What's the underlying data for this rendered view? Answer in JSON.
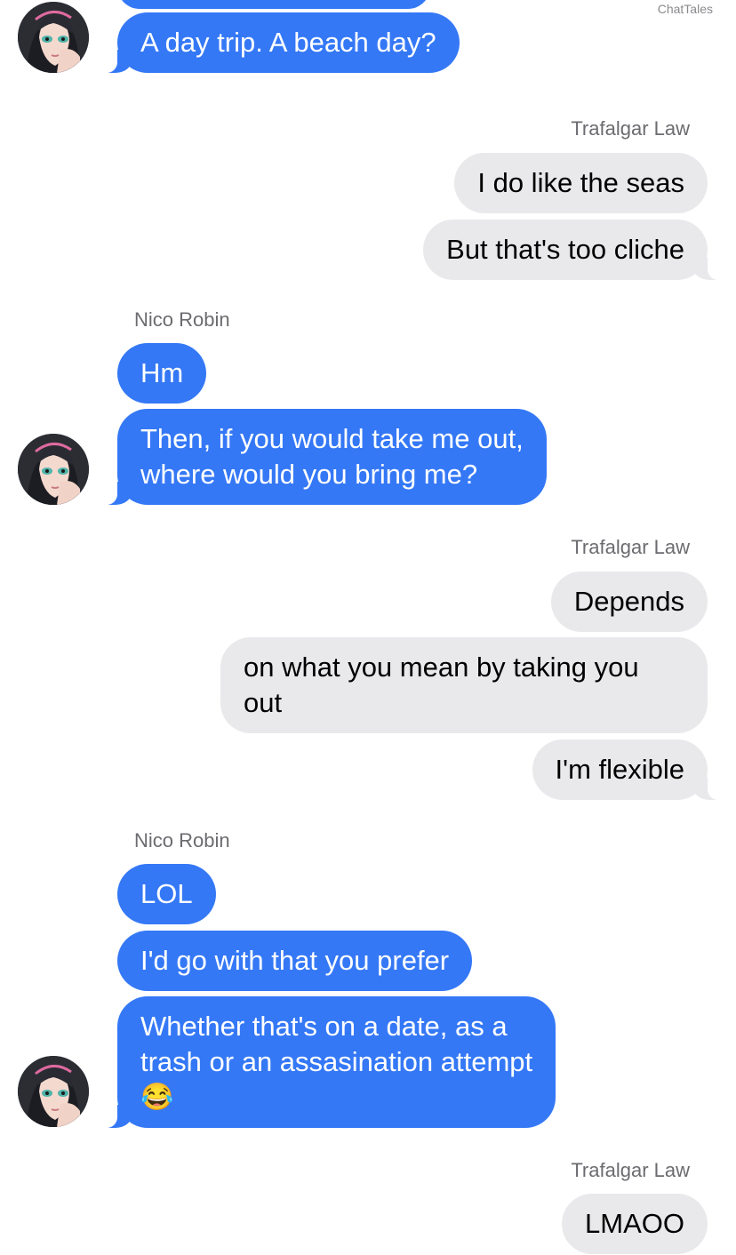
{
  "watermark": "ChatTales",
  "contacts": {
    "robin": "Nico Robin",
    "law": "Trafalgar Law"
  },
  "messages": {
    "m1": "A day trip. A beach day?",
    "m2": "I do like the seas",
    "m3": "But that's too cliche",
    "m4": "Hm",
    "m5_line1": "Then, if you would take me out,",
    "m5_line2": "where would you bring me?",
    "m6": "Depends",
    "m7_line1": "on what you mean by taking you",
    "m7_line2": "out",
    "m8": "I'm flexible",
    "m9": "LOL",
    "m10": "I'd go with that you prefer",
    "m11_line1": "Whether that's on a date, as a",
    "m11_line2": "trash or an assasination attempt",
    "m11_emoji": "😂",
    "m12": "LMAOO"
  },
  "colors": {
    "incoming": "#3478f6",
    "outgoing": "#e9e9eb",
    "name": "#6b6b70"
  },
  "icons": {
    "avatar": "nico-robin-avatar-icon"
  }
}
